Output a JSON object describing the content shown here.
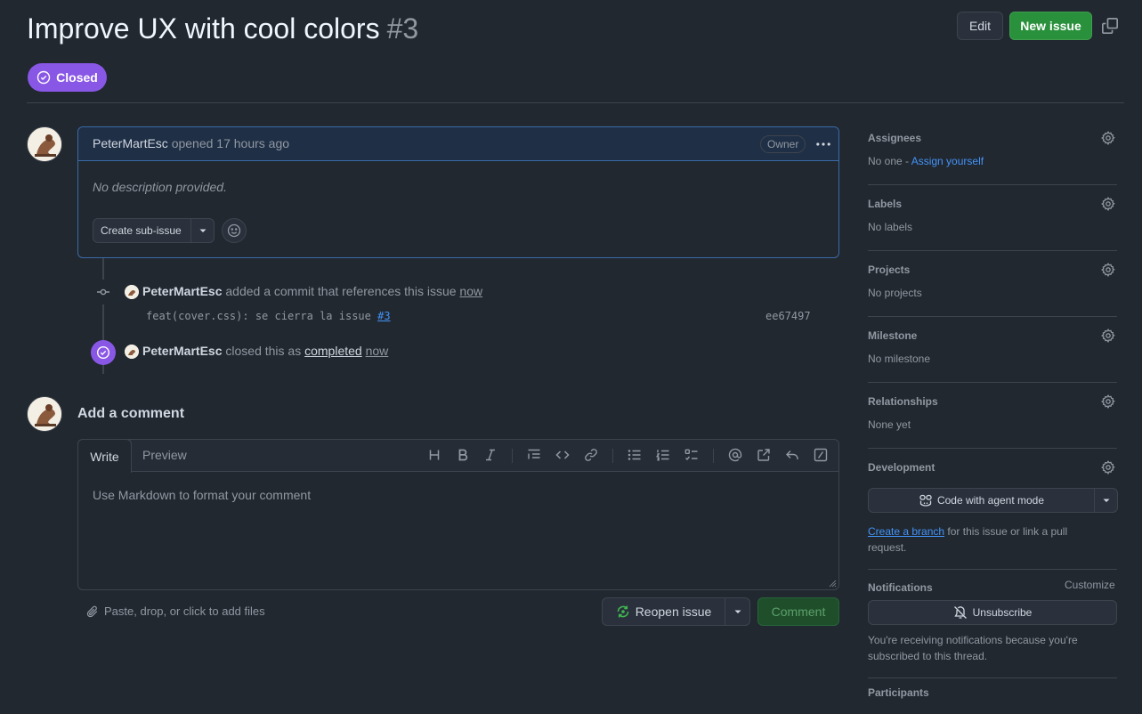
{
  "header": {
    "title": "Improve UX with cool colors",
    "number": "#3",
    "edit_label": "Edit",
    "new_issue_label": "New issue",
    "state_label": "Closed"
  },
  "issue": {
    "author": "PeterMartEsc",
    "opened_text": "opened 17 hours ago",
    "owner_badge": "Owner",
    "body": "No description provided.",
    "create_sub_issue_label": "Create sub-issue"
  },
  "timeline": [
    {
      "actor": "PeterMartEsc",
      "text": "added a commit that references this issue",
      "time": "now",
      "commit_message": "feat(cover.css): se cierra la issue",
      "commit_ref": "#3",
      "commit_hash": "ee67497"
    },
    {
      "actor": "PeterMartEsc",
      "text": "closed this as",
      "state": "completed",
      "time": "now"
    }
  ],
  "comment_form": {
    "title": "Add a comment",
    "tab_write": "Write",
    "tab_preview": "Preview",
    "placeholder": "Use Markdown to format your comment",
    "attach_text": "Paste, drop, or click to add files",
    "reopen_label": "Reopen issue",
    "comment_label": "Comment"
  },
  "sidebar": {
    "assignees": {
      "title": "Assignees",
      "value": "No one -",
      "action": "Assign yourself"
    },
    "labels": {
      "title": "Labels",
      "value": "No labels"
    },
    "projects": {
      "title": "Projects",
      "value": "No projects"
    },
    "milestone": {
      "title": "Milestone",
      "value": "No milestone"
    },
    "relationships": {
      "title": "Relationships",
      "value": "None yet"
    },
    "development": {
      "title": "Development",
      "agent_button": "Code with agent mode",
      "branch_link": "Create a branch",
      "branch_text": "for this issue or link a pull request."
    },
    "notifications": {
      "title": "Notifications",
      "customize": "Customize",
      "unsubscribe": "Unsubscribe",
      "info": "You're receiving notifications because you're subscribed to this thread."
    },
    "participants": {
      "title": "Participants"
    }
  },
  "colors": {
    "background": "#212830",
    "closed_purple": "#8957e5",
    "primary_green": "#29903b",
    "link_blue": "#4493f8"
  }
}
